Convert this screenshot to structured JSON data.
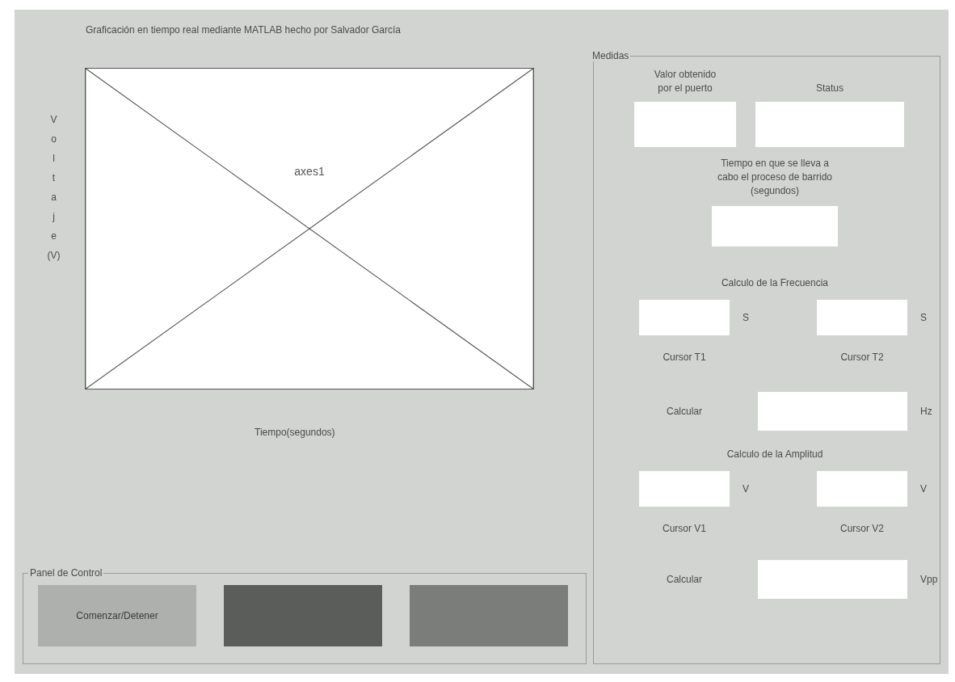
{
  "title": "Graficación en tiempo real mediante MATLAB hecho por Salvador García",
  "axes": {
    "label": "axes1",
    "ylabel": "Voltaje (V)",
    "xlabel": "Tiempo(segundos)"
  },
  "control_panel": {
    "title": "Panel de Control",
    "buttons": [
      {
        "label": "Comenzar/Detener",
        "color": "#aeb0ad"
      },
      {
        "color": "#5a5d5a"
      },
      {
        "color": "#7b7d7a"
      }
    ]
  },
  "measures": {
    "title": "Medidas",
    "port_value": {
      "label": "Valor obtenido por el puerto"
    },
    "status": {
      "label": "Status"
    },
    "sweep_time": {
      "label": "Tiempo en que se lleva a cabo el proceso de barrido (segundos)"
    },
    "frequency": {
      "title": "Calculo de la Frecuencia",
      "unit_1": "S",
      "unit_2": "S",
      "cursor_1": "Cursor T1",
      "cursor_2": "Cursor T2",
      "action": "Calcular",
      "result_unit": "Hz"
    },
    "amplitude": {
      "title": "Calculo de la Amplitud",
      "unit_1": "V",
      "unit_2": "V",
      "cursor_1": "Cursor V1",
      "cursor_2": "Cursor V2",
      "action": "Calcular",
      "result_unit": "Vpp"
    }
  }
}
